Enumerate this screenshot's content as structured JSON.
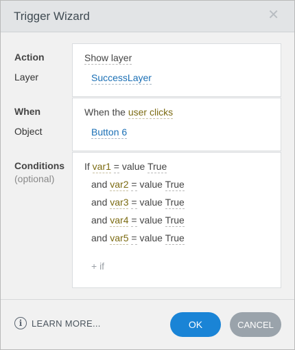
{
  "dialog": {
    "title": "Trigger Wizard",
    "close_glyph": "✕"
  },
  "action": {
    "label": "Action",
    "value": "Show layer",
    "sub_label": "Layer",
    "sub_value": "SuccessLayer"
  },
  "when": {
    "label": "When",
    "prefix": "When the",
    "event": "user clicks",
    "sub_label": "Object",
    "sub_value": "Button 6"
  },
  "conditions": {
    "label": "Conditions",
    "hint": "(optional)",
    "rows": [
      {
        "connector": "If",
        "variable": "var1",
        "op": "=",
        "value_kw": "value",
        "value": "True"
      },
      {
        "connector": "and",
        "variable": "var2",
        "op": "=",
        "value_kw": "value",
        "value": "True"
      },
      {
        "connector": "and",
        "variable": "var3",
        "op": "=",
        "value_kw": "value",
        "value": "True"
      },
      {
        "connector": "and",
        "variable": "var4",
        "op": "=",
        "value_kw": "value",
        "value": "True"
      },
      {
        "connector": "and",
        "variable": "var5",
        "op": "=",
        "value_kw": "value",
        "value": "True"
      }
    ],
    "add_label": "+ if"
  },
  "footer": {
    "info_glyph": "i",
    "learn_more": "LEARN MORE...",
    "ok_label": "OK",
    "cancel_label": "CANCEL"
  },
  "colors": {
    "ok_button": "#1a84d6",
    "cancel_button": "#9aa3ab",
    "link": "#1a6fb5",
    "variable": "#7c6b12"
  }
}
